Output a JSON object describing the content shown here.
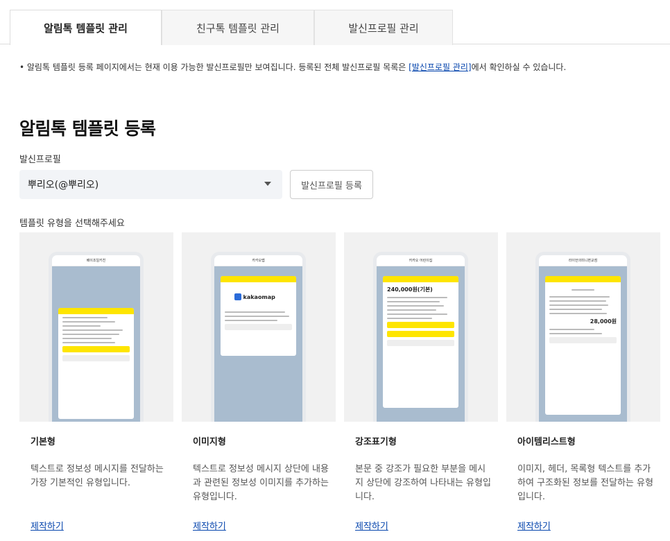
{
  "tabs": [
    {
      "label": "알림톡 템플릿 관리",
      "active": true
    },
    {
      "label": "친구톡 템플릿 관리",
      "active": false
    },
    {
      "label": "발신프로필 관리",
      "active": false
    }
  ],
  "notice": {
    "prefix": "• 알림톡 템플릿 등록 페이지에서는 현재 이용 가능한 발신프로필만 보여집니다. 등록된 전체 발신프로필 목록은 ",
    "link": "[발신프로필 관리]",
    "suffix": "에서 확인하실 수 있습니다."
  },
  "page_title": "알림톡 템플릿 등록",
  "sender_profile": {
    "label": "발신프로필",
    "selected": "뿌리오(@뿌리오)",
    "register_button": "발신프로필 등록"
  },
  "template_type_label": "템플릿 유형을 선택해주세요",
  "cards": [
    {
      "name": "기본형",
      "desc": "텍스트로 정보성 메시지를 전달하는 가장 기본적인 유형입니다.",
      "action": "제작하기",
      "phone_title": "베이조일키친"
    },
    {
      "name": "이미지형",
      "desc": "텍스트로 정보성 메시지 상단에 내용과 관련된 정보성 이미지를 추가하는 유형입니다.",
      "action": "제작하기",
      "phone_title": "카카오맵",
      "image_text": "kakaomap"
    },
    {
      "name": "강조표기형",
      "desc": "본문 중 강조가 필요한 부분을 메시지 상단에 강조하여 나타내는 유형입니다.",
      "action": "제작하기",
      "phone_title": "카카오 어린이집",
      "highlight": "240,000원(기본)"
    },
    {
      "name": "아이템리스트형",
      "desc": "이미지, 헤더, 목록형 텍스트를 추가하여 구조화된 정보를 전달하는 유형입니다.",
      "action": "제작하기",
      "phone_title": "라이언의미니편교점",
      "highlight": "28,000원"
    }
  ],
  "colors": {
    "kakao_yellow": "#fee500",
    "link": "#0645ad",
    "chat_bg": "#a9bccf"
  }
}
